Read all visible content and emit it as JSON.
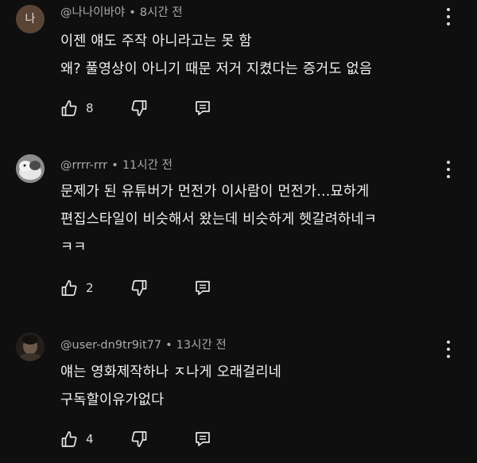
{
  "comments": [
    {
      "avatar_letter": "나",
      "author": "@나나이바야",
      "separator": "•",
      "time": "8시간 전",
      "lines": [
        "이젠 얘도 주작 아니라고는 못 함",
        "왜? 풀영상이 아니기 때문 저거 지켰다는 증거도 없음"
      ],
      "likes": "8"
    },
    {
      "avatar_letter": "",
      "author": "@rrrr-rrr",
      "separator": "•",
      "time": "11시간 전",
      "lines": [
        "문제가 된 유튜버가 먼전가 이사람이 먼전가...묘하게",
        "편집스타일이 비슷해서 왔는데 비슷하게 헷갈려하네ㅋ",
        "ㅋㅋ"
      ],
      "likes": "2"
    },
    {
      "avatar_letter": "",
      "author": "@user-dn9tr9it77",
      "separator": "•",
      "time": "13시간 전",
      "lines": [
        "얘는 영화제작하나 ㅈ나게 오래걸리네",
        "구독할이유가없다"
      ],
      "likes": "4"
    }
  ],
  "icons": {
    "like": "thumbs-up-icon",
    "dislike": "thumbs-down-icon",
    "reply": "reply-icon",
    "more": "more-vert-icon"
  },
  "colors": {
    "background": "#0f0f0f",
    "text": "#f1f1f1",
    "meta": "#aaaaaa"
  }
}
